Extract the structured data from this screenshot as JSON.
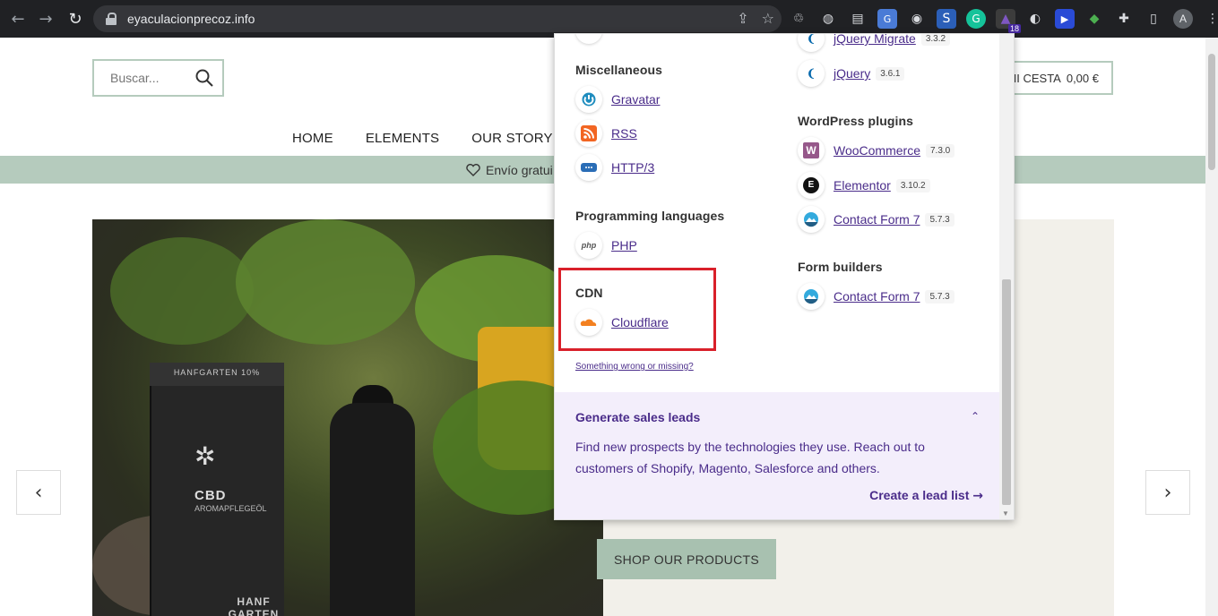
{
  "browser": {
    "url": "eyaculacionprecoz.info",
    "extension_badge": "18",
    "avatar_letter": "A"
  },
  "site": {
    "search_placeholder": "Buscar...",
    "cart_label": "MI CESTA",
    "cart_total": "0,00 €",
    "nav": [
      "HOME",
      "ELEMENTS",
      "OUR STORY"
    ],
    "promo_text": "Envío gratui",
    "shop_button": "SHOP OUR PRODUCTS",
    "product_box": {
      "top": "HANFGARTEN 10%",
      "brand": "CBD",
      "sub": "AROMAPFLEGEÖL",
      "logo": "HANF GARTEN"
    }
  },
  "popup": {
    "left": [
      {
        "category": "Miscellaneous",
        "items": [
          {
            "name": "Gravatar",
            "icon": "gravatar-icon"
          },
          {
            "name": "RSS",
            "icon": "rss-icon"
          },
          {
            "name": "HTTP/3",
            "icon": "http3-icon"
          }
        ]
      },
      {
        "category": "Programming languages",
        "items": [
          {
            "name": "PHP",
            "icon": "php-icon"
          }
        ]
      },
      {
        "category": "CDN",
        "items": [
          {
            "name": "Cloudflare",
            "icon": "cloudflare-icon"
          }
        ]
      }
    ],
    "right_top": [
      {
        "name": "jQuery Migrate",
        "version": "3.3.2"
      },
      {
        "name": "jQuery",
        "version": "3.6.1"
      }
    ],
    "right": [
      {
        "category": "WordPress plugins",
        "items": [
          {
            "name": "WooCommerce",
            "version": "7.3.0"
          },
          {
            "name": "Elementor",
            "version": "3.10.2"
          },
          {
            "name": "Contact Form 7",
            "version": "5.7.3"
          }
        ]
      },
      {
        "category": "Form builders",
        "items": [
          {
            "name": "Contact Form 7",
            "version": "5.7.3"
          }
        ]
      }
    ],
    "wrong_link": "Something wrong or missing?",
    "leads": {
      "title": "Generate sales leads",
      "description": "Find new prospects by the technologies they use. Reach out to customers of Shopify, Magento, Salesforce and others.",
      "cta": "Create a lead list"
    }
  },
  "colors": {
    "accent": "#4a2c8a",
    "brand_green": "#b5cbbd",
    "highlight": "#d9202a"
  }
}
